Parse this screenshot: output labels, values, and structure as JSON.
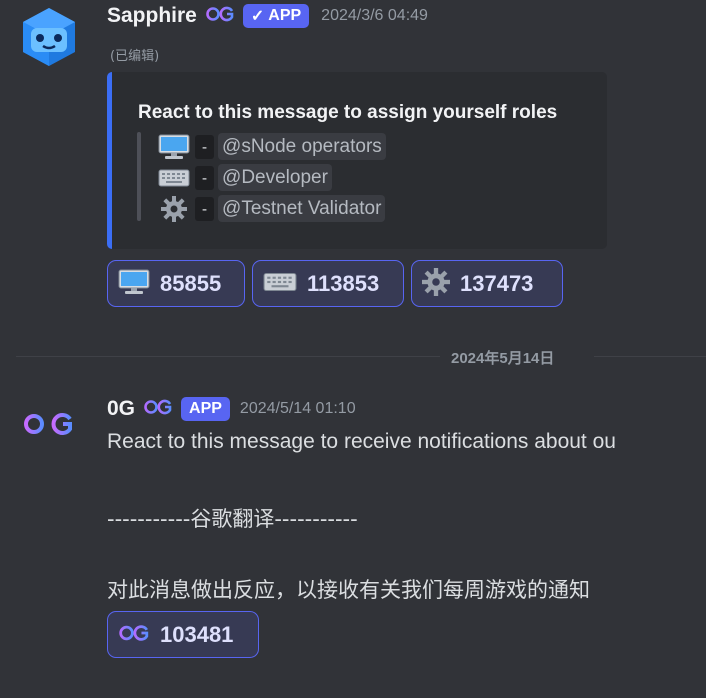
{
  "message1": {
    "author": "Sapphire",
    "badge": "APP",
    "badge_check": "✓",
    "timestamp": "2024/3/6 04:49",
    "edited": "(已编辑)",
    "embed": {
      "accent": "#3b6ef5",
      "title": "React to this message to assign yourself roles",
      "roles": [
        {
          "icon": "desktop-computer-icon",
          "dash": "-",
          "role": "@sNode operators"
        },
        {
          "icon": "keyboard-icon",
          "dash": "-",
          "role": "@Developer"
        },
        {
          "icon": "gear-icon",
          "dash": "-",
          "role": "@Testnet Validator"
        }
      ]
    },
    "reactions": [
      {
        "icon": "desktop-computer-icon",
        "count": "85855"
      },
      {
        "icon": "keyboard-icon",
        "count": "113853"
      },
      {
        "icon": "gear-icon",
        "count": "137473"
      }
    ]
  },
  "date_divider": "2024年5月14日",
  "message2": {
    "author": "0G",
    "badge": "APP",
    "timestamp": "2024/5/14 01:10",
    "lines": [
      "React to this message to receive notifications about ou",
      "-----------谷歌翻译-----------",
      "对此消息做出反应，以接收有关我们每周游戏的通知"
    ],
    "reactions": [
      {
        "icon": "0g-logo-icon",
        "count": "103481"
      }
    ]
  },
  "colors": {
    "background": "#313338",
    "badge": "#5865f2",
    "reaction_bg": "#373a54"
  }
}
